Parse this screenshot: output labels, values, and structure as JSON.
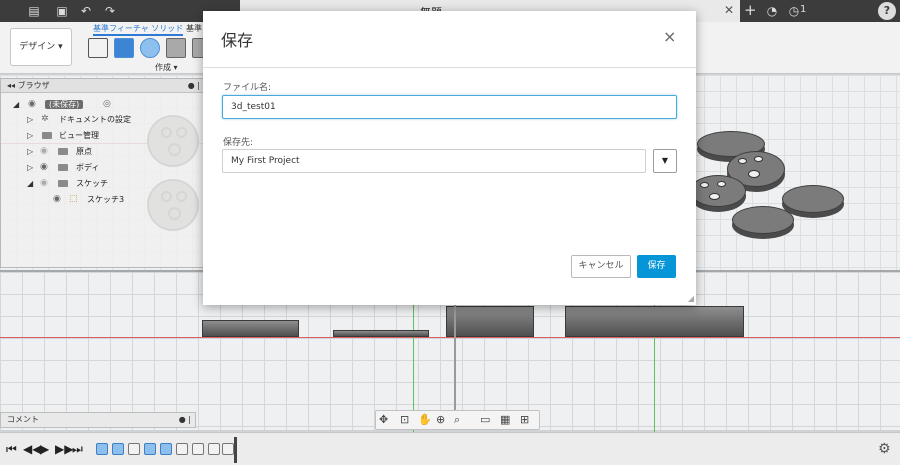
{
  "appbar": {
    "file_icon": "file-icon",
    "save_icon": "save-icon",
    "undo_icon": "undo-icon",
    "redo_icon": "redo-icon",
    "doc_title": "無題",
    "new_tab_icon": "plus-icon",
    "clock_badge": "1",
    "help_label": "?"
  },
  "toolbar": {
    "workspace_label": "デザイン ▾",
    "tab_solid": "基準フィーチャ ソリッド",
    "tab_next": "基準フ",
    "create_label": "作成 ▾"
  },
  "browser": {
    "title": "ブラウザ",
    "rows": [
      {
        "label": "(未保存)"
      },
      {
        "label": "ドキュメントの設定"
      },
      {
        "label": "ビュー管理"
      },
      {
        "label": "原点"
      },
      {
        "label": "ボディ"
      },
      {
        "label": "スケッチ"
      },
      {
        "label": "スケッチ3"
      }
    ]
  },
  "comments": {
    "label": "コメント"
  },
  "dialog": {
    "title": "保存",
    "close_label": "×",
    "name_label": "ファイル名:",
    "name_value": "3d_test01",
    "location_label": "保存先:",
    "location_value": "My First Project",
    "location_toggle": "▼",
    "cancel_label": "キャンセル",
    "save_label": "保存"
  },
  "colors": {
    "accent": "#0696d7",
    "input_focus": "#4aa9d8",
    "appbar": "#3c3c3c"
  }
}
